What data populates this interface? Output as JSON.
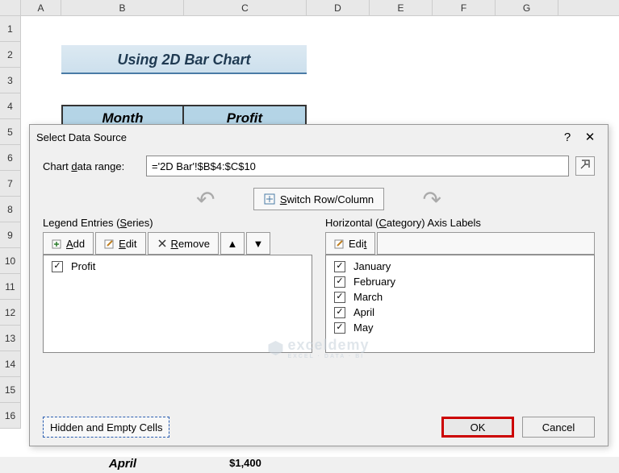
{
  "columns": [
    "A",
    "B",
    "C",
    "D",
    "E",
    "F",
    "G"
  ],
  "rows": [
    "1",
    "2",
    "3",
    "4",
    "5",
    "6",
    "7",
    "8",
    "9",
    "10",
    "11",
    "12",
    "13",
    "14",
    "15",
    "16"
  ],
  "sheet": {
    "title": "Using 2D Bar Chart",
    "headers": {
      "month": "Month",
      "profit": "Profit"
    },
    "peek_row": {
      "month": "April",
      "profit": "$1,400"
    }
  },
  "dialog": {
    "title": "Select Data Source",
    "help": "?",
    "close": "✕",
    "range_label_pre": "Chart ",
    "range_label_u": "d",
    "range_label_post": "ata range:",
    "range_value": "='2D Bar'!$B$4:$C$10",
    "switch_u": "S",
    "switch_rest": "witch Row/Column",
    "legend_label_pre": "Legend Entries (",
    "legend_label_u": "S",
    "legend_label_post": "eries)",
    "axis_label_pre": "Horizontal (",
    "axis_label_u": "C",
    "axis_label_post": "ategory) Axis Labels",
    "add_u": "A",
    "add_rest": "dd",
    "edit_u": "E",
    "edit_rest": "dit",
    "edit2_rest": "di",
    "edit2_u": "t",
    "remove_u": "R",
    "remove_rest": "emove",
    "series": [
      {
        "checked": true,
        "name": "Profit"
      }
    ],
    "categories": [
      {
        "checked": true,
        "name": "January"
      },
      {
        "checked": true,
        "name": "February"
      },
      {
        "checked": true,
        "name": "March"
      },
      {
        "checked": true,
        "name": "April"
      },
      {
        "checked": true,
        "name": "May"
      }
    ],
    "hidden_u": "H",
    "hidden_rest": "idden and Empty Cells",
    "ok": "OK",
    "cancel": "Cancel"
  },
  "watermark": {
    "brand": "exceldemy",
    "sub": "EXCEL · DATA · BI"
  }
}
